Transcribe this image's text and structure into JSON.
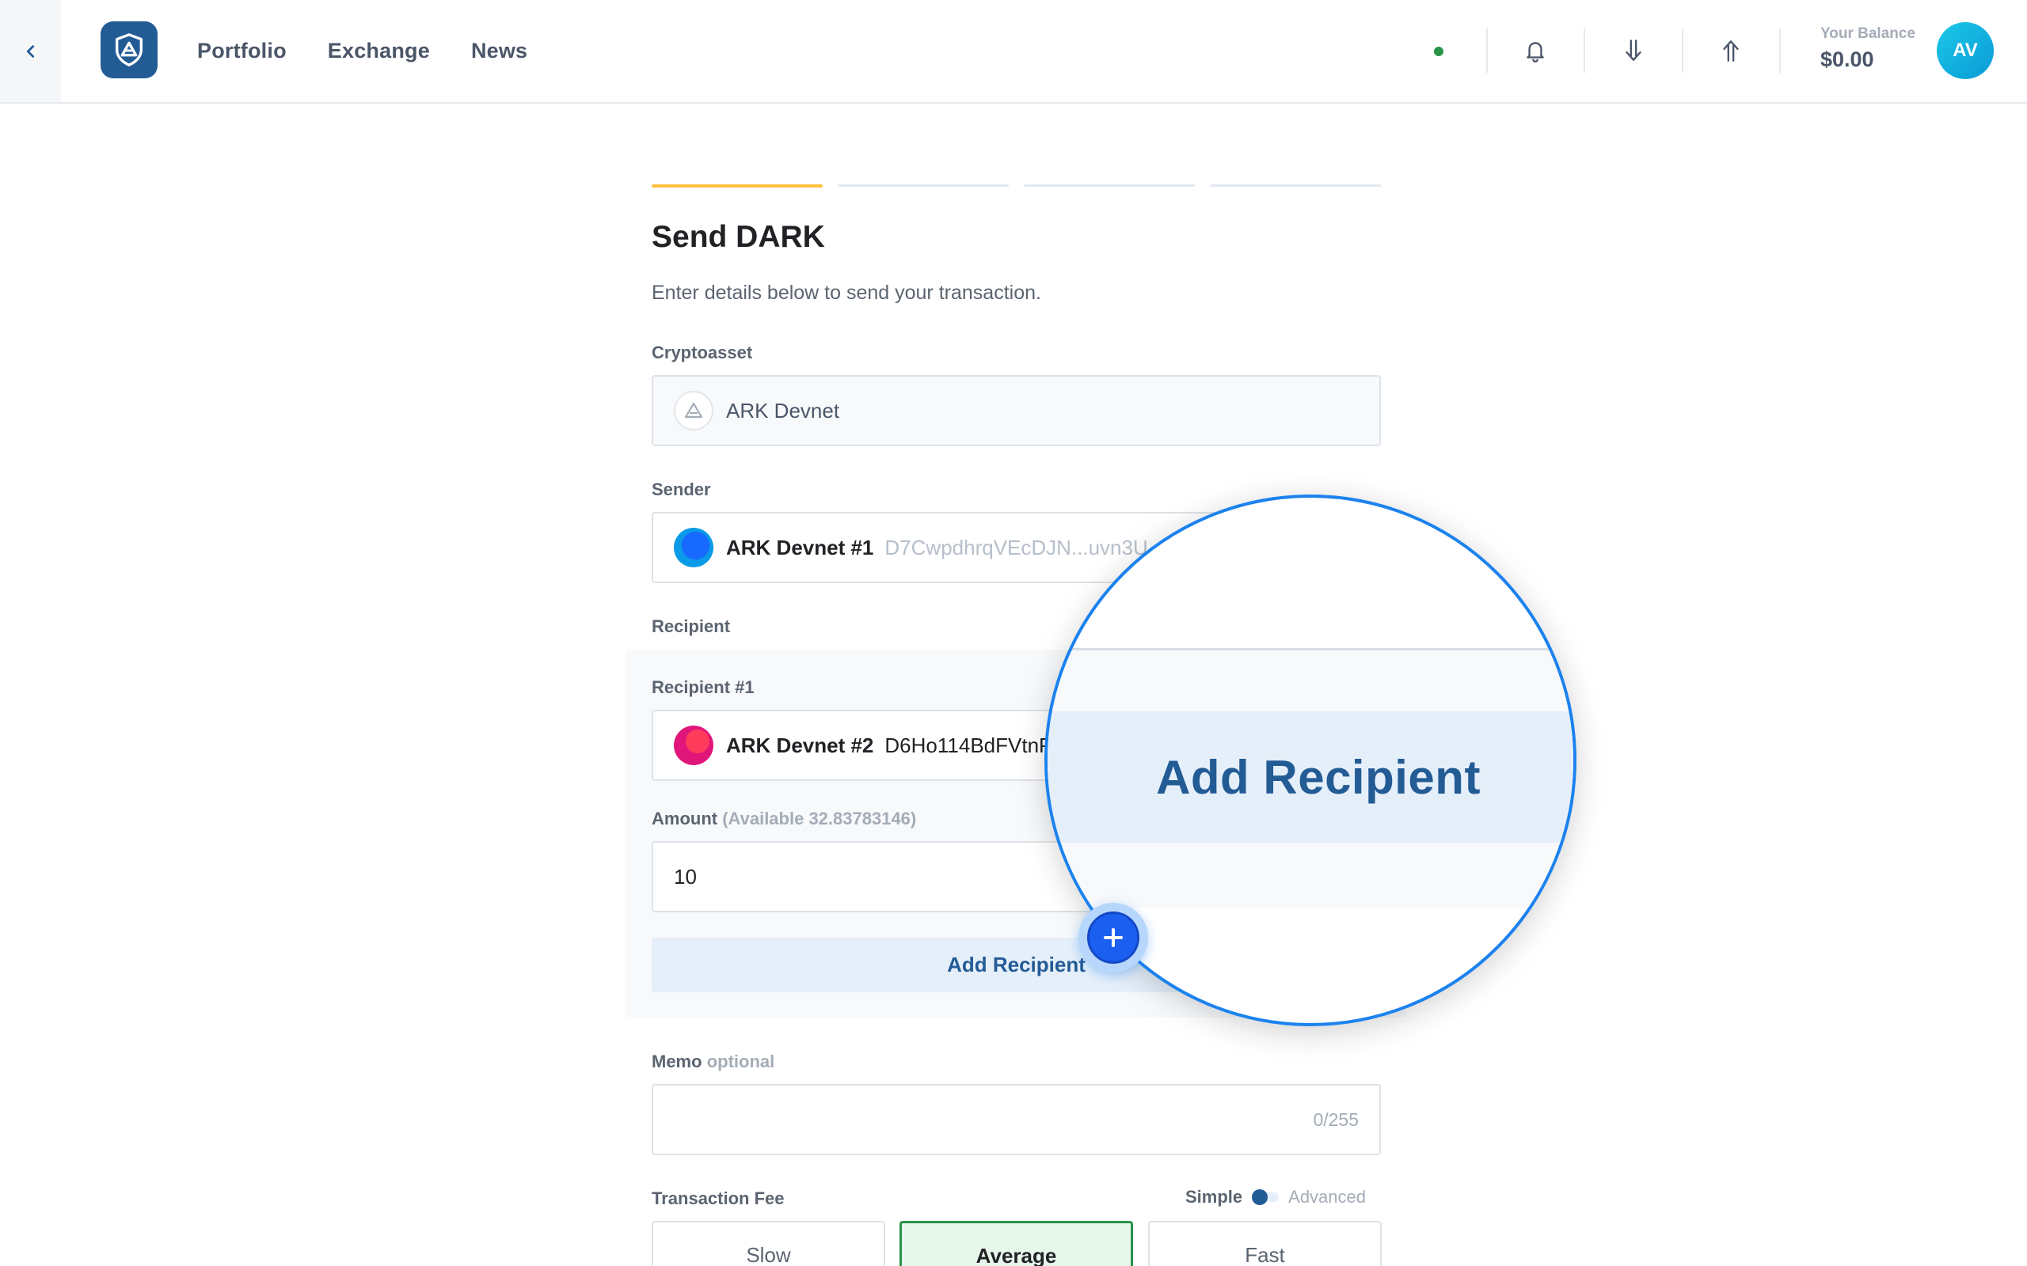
{
  "topbar": {
    "nav": [
      "Portfolio",
      "Exchange",
      "News"
    ],
    "balance_label": "Your Balance",
    "balance_value": "$0.00",
    "avatar_initials": "AV",
    "status_color": "#289548"
  },
  "form": {
    "steps_total": 4,
    "steps_active": 1,
    "title": "Send DARK",
    "subtitle": "Enter details below to send your transaction.",
    "cryptoasset_label": "Cryptoasset",
    "cryptoasset_value": "ARK Devnet",
    "sender_label": "Sender",
    "sender_name": "ARK Devnet #1",
    "sender_address": "D7CwpdhrqVEcDJN...uvn3U",
    "recipient_label": "Recipient",
    "recipient1_label": "Recipient #1",
    "recipient1_name": "ARK Devnet #2",
    "recipient1_address": "D6Ho114BdFVtnP",
    "amount_label": "Amount",
    "amount_available": "(Available 32.83783146)",
    "amount_value": "10",
    "add_recipient": "Add Recipient",
    "memo_label": "Memo",
    "memo_optional": "optional",
    "memo_counter": "0/255",
    "fee_label": "Transaction Fee",
    "fee_mode_simple": "Simple",
    "fee_mode_advanced": "Advanced",
    "fee_options": [
      "Slow",
      "Average",
      "Fast"
    ],
    "fee_selected": "Average"
  },
  "magnifier": {
    "text": "Add Recipient"
  },
  "colors": {
    "brand": "#235b95",
    "accent_step": "#ffc13d",
    "magnifier_ring": "#1b82ee",
    "selected_fee": "#289548"
  }
}
